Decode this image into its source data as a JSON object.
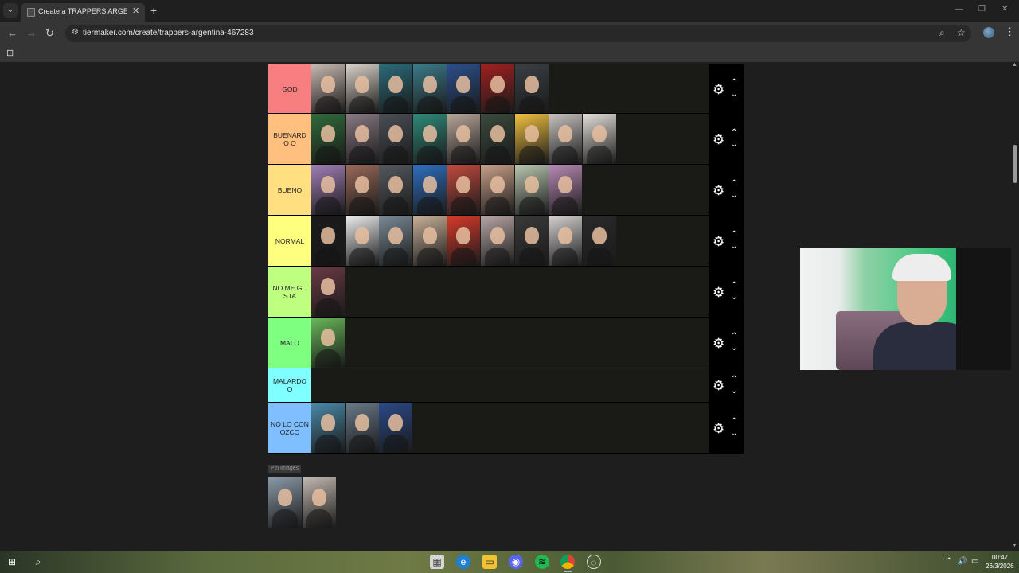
{
  "browser": {
    "tab_title": "Create a TRAPPERS ARGENTINA",
    "url": "tiermaker.com/create/trappers-argentina-467283"
  },
  "tiers": [
    {
      "label": "GOD",
      "color": "#f87f7f",
      "count": 7,
      "swatches": [
        "#c7b8b0",
        "#d9d2c8",
        "#2a6b7a",
        "#3c7a8a",
        "#2b4f8a",
        "#a02020",
        "#3a3f44"
      ]
    },
    {
      "label": "BUENARDO O",
      "color": "#ffbf7f",
      "count": 9,
      "swatches": [
        "#2f6b3a",
        "#8a7a85",
        "#4a4f56",
        "#2f8a7a",
        "#b8a69a",
        "#3a4a3e",
        "#f0c040",
        "#c7c2c0",
        "#e3e0da"
      ]
    },
    {
      "label": "BUENO",
      "color": "#ffdf7f",
      "count": 8,
      "swatches": [
        "#a27fb8",
        "#9a6a5a",
        "#55595e",
        "#2f6fc0",
        "#c24b3e",
        "#c9a08a",
        "#b9c7b0",
        "#b98ab5"
      ]
    },
    {
      "label": "NORMAL",
      "color": "#ffff7f",
      "count": 9,
      "swatches": [
        "#1a1a1a",
        "#eeeeee",
        "#7a8a96",
        "#c8b098",
        "#d83a2a",
        "#b8a6a6",
        "#3a3a3a",
        "#d6d2d2",
        "#2a2a2a"
      ]
    },
    {
      "label": "NO ME GUSTA",
      "color": "#bfff7f",
      "count": 1,
      "swatches": [
        "#6a3a45"
      ]
    },
    {
      "label": "MALO",
      "color": "#7fff7f",
      "count": 1,
      "swatches": [
        "#6ab85a"
      ]
    },
    {
      "label": "MALARDOO",
      "color": "#7fffff",
      "count": 0,
      "swatches": []
    },
    {
      "label": "NO LO CONOZCO",
      "color": "#7fbfff",
      "count": 3,
      "swatches": [
        "#4a8aa8",
        "#6a7a8a",
        "#2a4a8a"
      ]
    }
  ],
  "pin": {
    "label": "Pin Images",
    "swatches": [
      "#8a9aa8",
      "#c2b8b0"
    ]
  },
  "taskbar": {
    "time": "00:47",
    "date": "26/3/2026"
  }
}
